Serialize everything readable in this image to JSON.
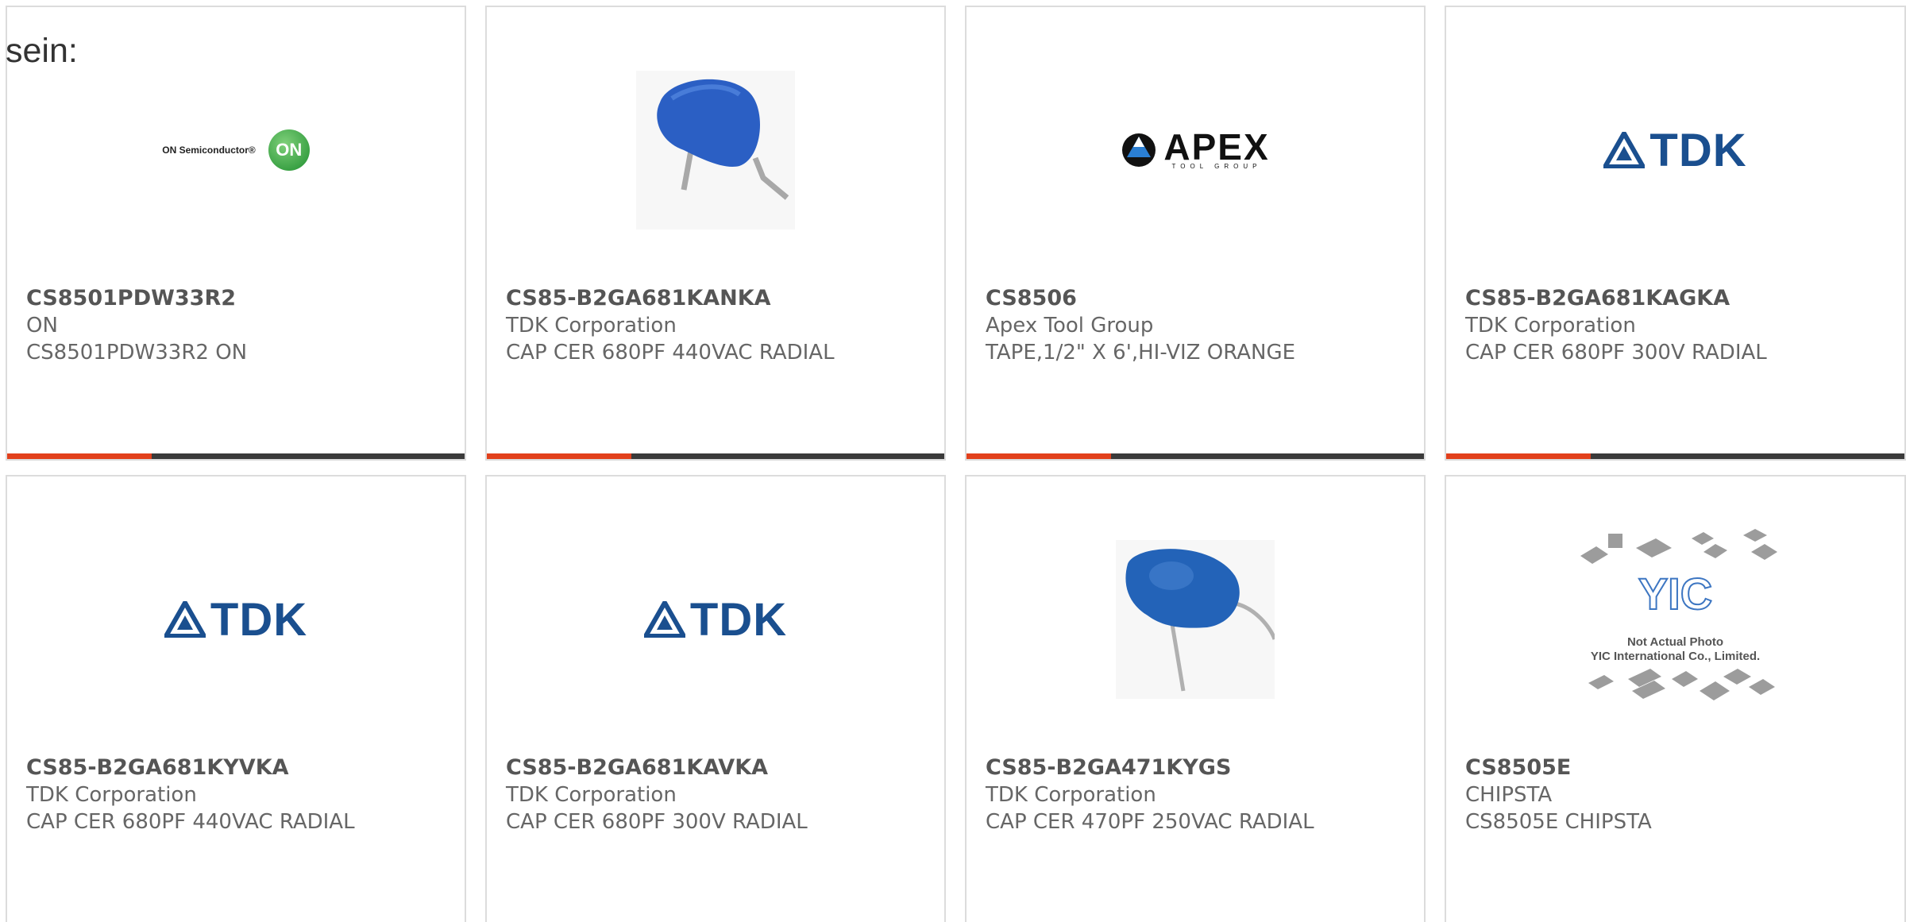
{
  "intro_text": "sein:",
  "cards": [
    {
      "part_number": "CS8501PDW33R2",
      "manufacturer": "ON",
      "description": "CS8501PDW33R2 ON",
      "image": "on-semiconductor-logo",
      "logo_text": "ON Semiconductor®",
      "badge_text": "ON"
    },
    {
      "part_number": "CS85-B2GA681KANKA",
      "manufacturer": "TDK Corporation",
      "description": "CAP CER 680PF 440VAC RADIAL",
      "image": "ceramic-capacitor-photo"
    },
    {
      "part_number": "CS8506",
      "manufacturer": "Apex Tool Group",
      "description": "TAPE,1/2\" X 6',HI-VIZ ORANGE",
      "image": "apex-tool-group-logo",
      "logo_text": "APEX",
      "logo_sub": "TOOL GROUP"
    },
    {
      "part_number": "CS85-B2GA681KAGKA",
      "manufacturer": "TDK Corporation",
      "description": "CAP CER 680PF 300V RADIAL",
      "image": "tdk-logo",
      "logo_text": "TDK"
    },
    {
      "part_number": "CS85-B2GA681KYVKA",
      "manufacturer": "TDK Corporation",
      "description": "CAP CER 680PF 440VAC RADIAL",
      "image": "tdk-logo",
      "logo_text": "TDK"
    },
    {
      "part_number": "CS85-B2GA681KAVKA",
      "manufacturer": "TDK Corporation",
      "description": "CAP CER 680PF 300V RADIAL",
      "image": "tdk-logo",
      "logo_text": "TDK"
    },
    {
      "part_number": "CS85-B2GA471KYGS",
      "manufacturer": "TDK Corporation",
      "description": "CAP CER 470PF 250VAC RADIAL",
      "image": "ceramic-capacitor-photo"
    },
    {
      "part_number": "CS8505E",
      "manufacturer": "CHIPSTA",
      "description": "CS8505E CHIPSTA",
      "image": "yic-placeholder",
      "logo_text": "YIC",
      "caption_line1": "Not Actual Photo",
      "caption_line2": "YIC International Co., Limited."
    }
  ],
  "colors": {
    "accent_bar": "#e2401c",
    "bar_track": "#3a3a3a",
    "card_border": "#dcdcdc",
    "tdk_blue": "#1a4f8f"
  }
}
